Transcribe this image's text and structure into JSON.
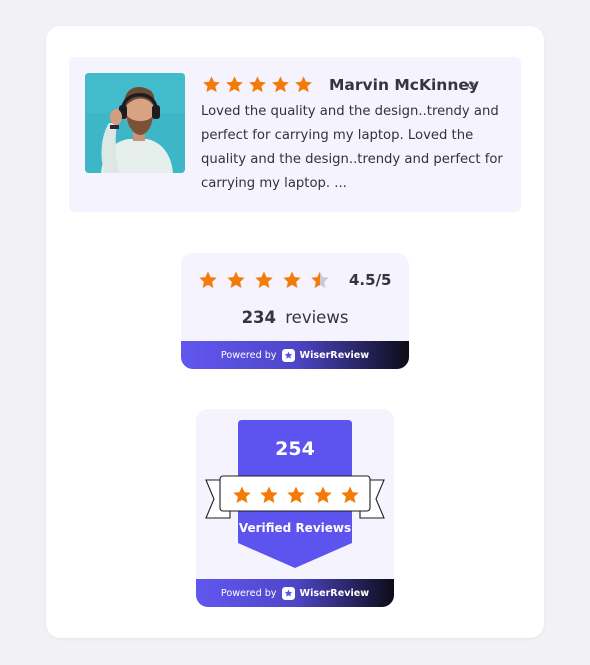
{
  "colors": {
    "accent": "#5a52ea",
    "star": "#f47b0a",
    "star_empty": "#c9c9d1",
    "panel": "#f4f3fe"
  },
  "review": {
    "reviewer_name": "Marvin McKinney",
    "rating": 5,
    "text": "Loved the quality and the design..trendy and perfect for carrying my laptop. Loved the quality and the design..trendy and perfect for carrying my laptop. ...",
    "avatar_icon": "person-headphones-photo",
    "verified_icon": "verified-dot-icon"
  },
  "rating_widget": {
    "rating": 4.5,
    "score_text": "4.5/5",
    "review_count": "234",
    "reviews_label": "reviews",
    "powered_by": "Powered by",
    "brand": "WiserReview"
  },
  "badge_widget": {
    "count": "254",
    "rating": 5,
    "label": "Verified Reviews",
    "powered_by": "Powered by",
    "brand": "WiserReview"
  }
}
